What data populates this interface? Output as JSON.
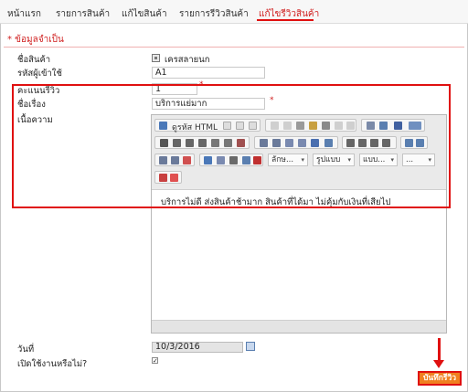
{
  "tabs": [
    "หน้าแรก",
    "รายการสินค้า",
    "แก้ไขสินค้า",
    "รายการรีวิวสินค้า",
    "แก้ไขรีวิวสินค้า"
  ],
  "required_note": "* ข้อมูลจำเป็น",
  "form": {
    "product_label": "ชื่อสินค้า",
    "product_value": "เครสลายนก",
    "user_label": "รหัสผู้เข้าใช้",
    "user_value": "A1",
    "rating_label": "คะแนนรีวิว",
    "rating_value": "1",
    "title_label": "ชื่อเรื่อง",
    "title_value": "บริการแย่มาก",
    "content_label": "เนื้อความ",
    "date_label": "วันที่",
    "date_value": "10/3/2016",
    "enabled_label": "เปิดใช้งานหรือไม่?",
    "enabled_checked": true
  },
  "editor": {
    "source_label": "ดูรหัส HTML",
    "format_dropdown": "ลักษ...",
    "style_dropdown": "รูปแบบ",
    "font_dropdown": "แบบ...",
    "size_dropdown": "...",
    "content": "บริการไม่ดี ส่งสินค้าช้ามาก สินค้าที่ได้มา ไม่คุ้มกับเงินที่เสียไป"
  },
  "save_button": "บันทึกรีวิว",
  "colors": {
    "accent": "#e01010",
    "button": "#f08020"
  }
}
